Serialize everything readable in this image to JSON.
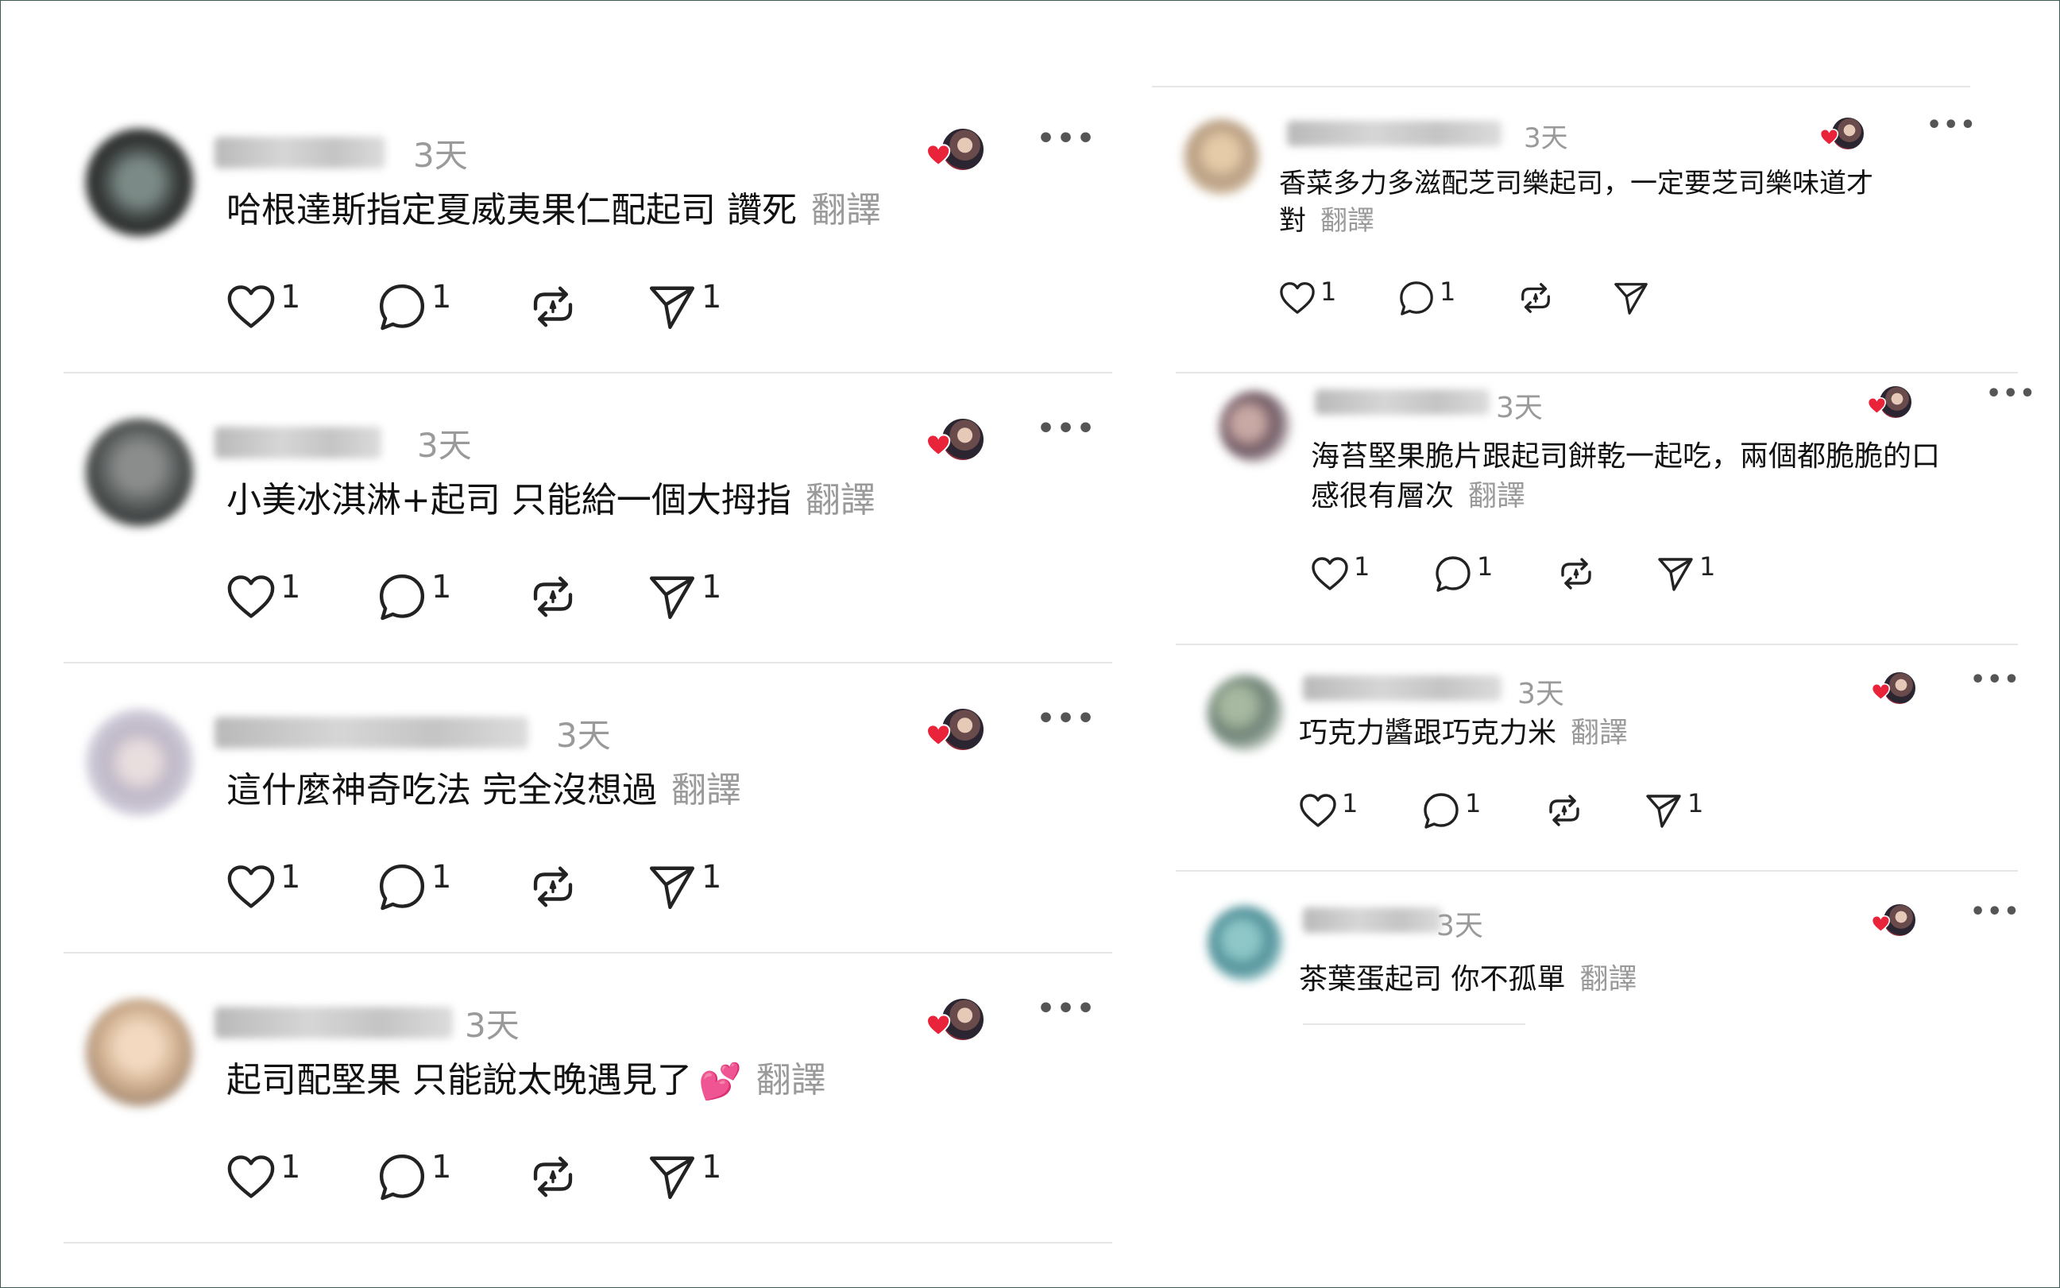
{
  "left": {
    "posts": [
      {
        "time": "3天",
        "text": "哈根達斯指定夏威夷果仁配起司 讚死",
        "translate": "翻譯",
        "likes": "1",
        "replies": "1",
        "shares": "1"
      },
      {
        "time": "3天",
        "text": "小美冰淇淋+起司 只能給一個大拇指",
        "translate": "翻譯",
        "likes": "1",
        "replies": "1",
        "shares": "1"
      },
      {
        "time": "3天",
        "text": "這什麼神奇吃法 完全沒想過",
        "translate": "翻譯",
        "likes": "1",
        "replies": "1",
        "shares": "1"
      },
      {
        "time": "3天",
        "text": "起司配堅果 只能說太晚遇見了",
        "emoji": "💕",
        "translate": "翻譯",
        "likes": "1",
        "replies": "1",
        "shares": "1"
      }
    ]
  },
  "right": {
    "posts": [
      {
        "time": "3天",
        "line1": "香菜多力多滋配芝司樂起司，一定要芝司樂味道才",
        "line2": "對",
        "translate": "翻譯",
        "likes": "1",
        "replies": "1"
      },
      {
        "time": "3天",
        "line1": "海苔堅果脆片跟起司餅乾一起吃，兩個都脆脆的口",
        "line2": "感很有層次",
        "translate": "翻譯",
        "likes": "1",
        "replies": "1",
        "shares": "1"
      },
      {
        "time": "3天",
        "line1": "巧克力醬跟巧克力米",
        "translate": "翻譯",
        "likes": "1",
        "replies": "1",
        "shares": "1"
      },
      {
        "time": "3天",
        "line1": "茶葉蛋起司 你不孤單",
        "translate": "翻譯"
      }
    ]
  },
  "icons": {
    "like": "heart-icon",
    "reply": "comment-icon",
    "repost": "repost-icon",
    "share": "send-icon",
    "more": "more-icon",
    "liked_by_author": "liked-by-author-icon"
  },
  "colors": {
    "heart": "#e8233a",
    "muted": "#9a9a9a",
    "divider": "#e6e6e6"
  }
}
